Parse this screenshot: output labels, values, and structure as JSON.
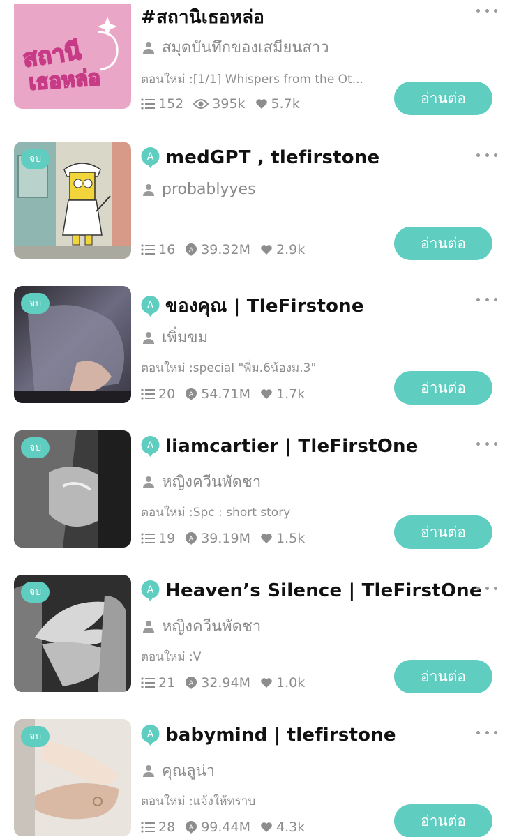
{
  "colors": {
    "accent": "#5fcdc0",
    "muted": "#8d8d8d",
    "title": "#111111"
  },
  "stories": [
    {
      "title": "#สถานิเธอหล่อ",
      "author": "สมุดบันทึกของเสมียนสาว",
      "has_type_icon": false,
      "completed_badge": "",
      "latest_prefix": "ตอนใหม่ :",
      "latest_episode": "[1/1] Whispers from the Ot...",
      "chapters": "152",
      "second_stat_icon": "eye-icon",
      "views": "395k",
      "likes": "5.7k",
      "read_button": "อ่านต่อ",
      "cover_text": [
        "สถานี",
        "เธอหล่อ"
      ]
    },
    {
      "title": "medGPT , tlefirstone",
      "author": "probablyyes",
      "has_type_icon": true,
      "completed_badge": "จบ",
      "latest_prefix": "",
      "latest_episode": "",
      "chapters": "16",
      "second_stat_icon": "reads-icon",
      "views": "39.32M",
      "likes": "2.9k",
      "read_button": "อ่านต่อ"
    },
    {
      "title": " ของคุณ | TleFirstone",
      "author": "เพิ่มขม",
      "has_type_icon": true,
      "completed_badge": "จบ",
      "latest_prefix": "ตอนใหม่ :",
      "latest_episode": "special \"พี่ม.6น้องม.3\"",
      "chapters": "20",
      "second_stat_icon": "reads-icon",
      "views": "54.71M",
      "likes": "1.7k",
      "read_button": "อ่านต่อ"
    },
    {
      "title": "liamcartier | TleFirstOne",
      "author": "หญิงควีนพัดชา",
      "has_type_icon": true,
      "completed_badge": "จบ",
      "latest_prefix": "ตอนใหม่ :",
      "latest_episode": "Spc : short story",
      "chapters": "19",
      "second_stat_icon": "reads-icon",
      "views": "39.19M",
      "likes": "1.5k",
      "read_button": "อ่านต่อ"
    },
    {
      "title": "Heaven’s Silence | TleFirstOne",
      "author": "หญิงควีนพัดชา",
      "has_type_icon": true,
      "completed_badge": "จบ",
      "latest_prefix": "ตอนใหม่ :",
      "latest_episode": "V",
      "chapters": "21",
      "second_stat_icon": "reads-icon",
      "views": "32.94M",
      "likes": "1.0k",
      "read_button": "อ่านต่อ"
    },
    {
      "title": "babymind | tlefirstone",
      "author": "คุณลูน่า",
      "has_type_icon": true,
      "completed_badge": "จบ",
      "latest_prefix": "ตอนใหม่ :",
      "latest_episode": "แจ้งให้ทราบ",
      "chapters": "28",
      "second_stat_icon": "reads-icon",
      "views": "99.44M",
      "likes": "4.3k",
      "read_button": "อ่านต่อ"
    }
  ]
}
